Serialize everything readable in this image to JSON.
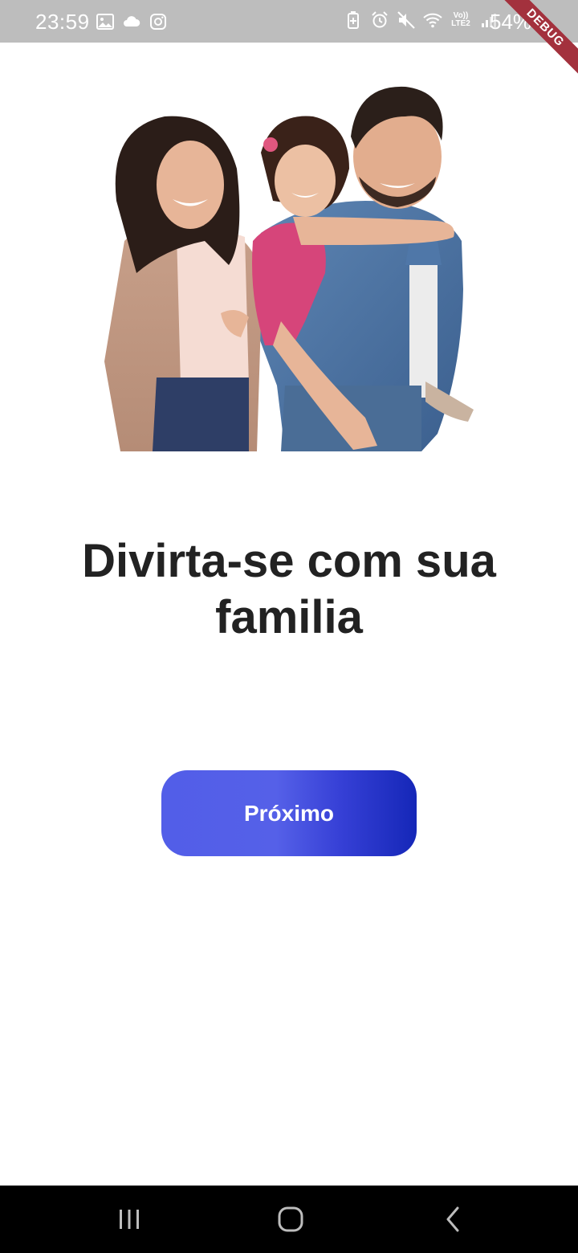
{
  "status_bar": {
    "time": "23:59",
    "battery_percent": "54%",
    "network_label": "Vo)) LTE2",
    "left_icons": [
      "image-icon",
      "cloud-icon",
      "instagram-icon"
    ],
    "right_icons": [
      "battery-saver-icon",
      "alarm-icon",
      "mute-icon",
      "wifi-icon",
      "lte-icon",
      "signal-icon",
      "battery-icon"
    ]
  },
  "debug_banner": "DEBUG",
  "onboarding": {
    "title": "Divirta-se com sua familia",
    "next_label": "Próximo"
  },
  "nav_bar": {
    "buttons": [
      "recent-apps-icon",
      "home-icon",
      "back-icon"
    ]
  },
  "colors": {
    "button_start": "#525ee8",
    "button_end": "#1527b8",
    "title": "#222222",
    "status_bar": "#bdbdbd",
    "debug_ribbon": "#a3313d"
  }
}
